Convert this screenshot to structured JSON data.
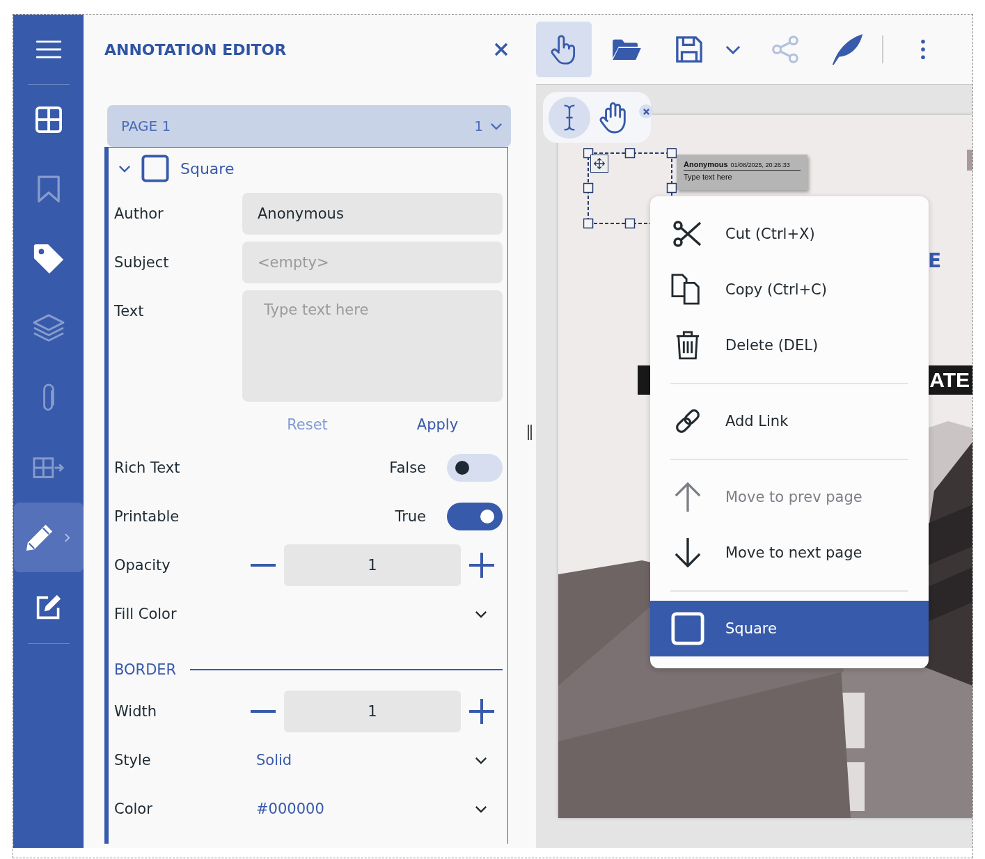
{
  "sidebar": {
    "items": [
      {
        "selected": false,
        "disabled": false
      },
      {
        "selected": false,
        "disabled": true
      },
      {
        "selected": false,
        "disabled": false
      },
      {
        "selected": false,
        "disabled": true
      },
      {
        "selected": false,
        "disabled": true
      },
      {
        "selected": false,
        "disabled": true
      },
      {
        "selected": true,
        "disabled": false
      },
      {
        "selected": false,
        "disabled": false
      }
    ]
  },
  "editor": {
    "title": "ANNOTATION EDITOR",
    "page_selector": {
      "label": "PAGE 1",
      "count": "1"
    },
    "annotation": {
      "title": "Square",
      "expanded": true,
      "fields": [
        {
          "label": "Author",
          "value": "Anonymous",
          "multiline": false
        },
        {
          "label": "Subject",
          "placeholder": "<empty>",
          "multiline": false
        },
        {
          "label": "Text",
          "placeholder": "Type text here",
          "multiline": true
        }
      ],
      "actions": [
        {
          "label": "Reset",
          "disabled": true
        },
        {
          "label": "Apply",
          "disabled": false
        }
      ],
      "settings": [
        {
          "kind": "toggle",
          "label": "Rich Text",
          "value": "False",
          "on": false
        },
        {
          "kind": "toggle",
          "label": "Printable",
          "value": "True",
          "on": true
        },
        {
          "kind": "stepper",
          "label": "Opacity",
          "value": "1"
        },
        {
          "kind": "dropdown",
          "label": "Fill Color"
        }
      ],
      "border": {
        "title": "BORDER",
        "settings": [
          {
            "kind": "stepper",
            "label": "Width",
            "value": "1"
          },
          {
            "kind": "dropdown",
            "label": "Style",
            "value": "Solid"
          },
          {
            "kind": "dropdown",
            "label": "Color",
            "value": "#000000"
          }
        ]
      }
    }
  },
  "toolbar": {
    "buttons": [
      {
        "selected": true,
        "disabled": false
      },
      {
        "selected": false,
        "disabled": false
      },
      {
        "selected": false,
        "disabled": false
      },
      {
        "selected": false,
        "disabled": false
      },
      {
        "selected": false,
        "disabled": true
      },
      {
        "selected": false,
        "disabled": false
      },
      {
        "selected": false,
        "disabled": false
      }
    ]
  },
  "floating_tools": {
    "tools": [
      {
        "selected": true
      },
      {
        "selected": false
      }
    ]
  },
  "document": {
    "heading_fragment": "E",
    "banner_fragment": "ATE",
    "annotation": {
      "selected": true,
      "popup": {
        "author": "Anonymous",
        "date": "01/08/2025, 20:26:33",
        "text": "Type text here"
      }
    }
  },
  "context_menu": {
    "groups": [
      {
        "items": [
          {
            "label": "Cut (Ctrl+X)",
            "disabled": false,
            "selected": false
          },
          {
            "label": "Copy (Ctrl+C)",
            "disabled": false,
            "selected": false
          },
          {
            "label": "Delete (DEL)",
            "disabled": false,
            "selected": false
          }
        ]
      },
      {
        "items": [
          {
            "label": "Add Link",
            "disabled": false,
            "selected": false
          }
        ]
      },
      {
        "items": [
          {
            "label": "Move to prev page",
            "disabled": true,
            "selected": false
          },
          {
            "label": "Move to next page",
            "disabled": false,
            "selected": false
          }
        ]
      },
      {
        "items": [
          {
            "label": "Square",
            "disabled": false,
            "selected": true
          }
        ]
      }
    ]
  }
}
